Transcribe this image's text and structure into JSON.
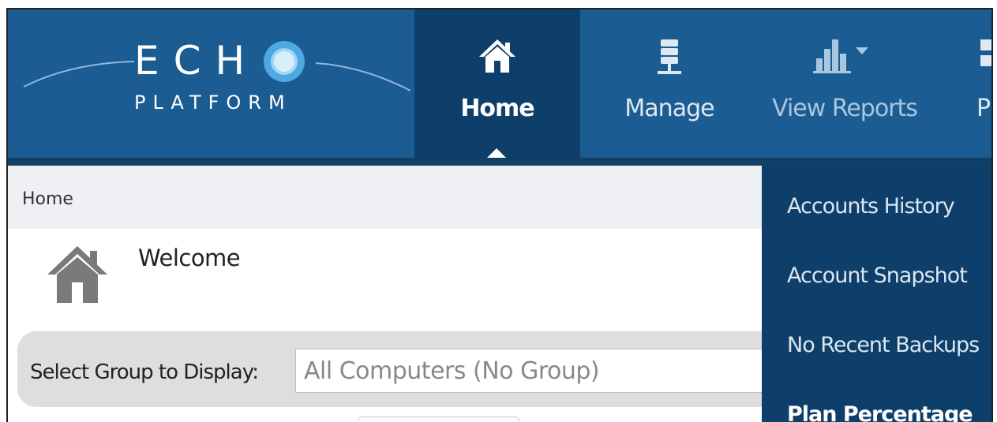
{
  "logo": {
    "word": "ECH",
    "subtitle": "PLATFORM"
  },
  "nav": {
    "home": "Home",
    "manage": "Manage",
    "reports": "View Reports",
    "more": "P"
  },
  "breadcrumb": "Home",
  "welcome": "Welcome",
  "group": {
    "label": "Select Group to Display:",
    "selected": "All Computers (No Group)"
  },
  "dropdown": {
    "items": [
      "Accounts History",
      "Account Snapshot",
      "No Recent Backups",
      "Plan Percentage"
    ]
  },
  "colors": {
    "navbar": "#1b5c92",
    "active": "#0e3f6a"
  }
}
